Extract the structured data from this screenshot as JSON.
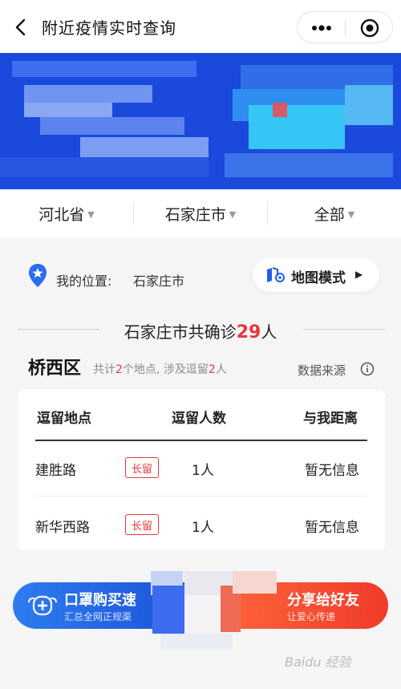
{
  "header": {
    "title": "附近疫情实时查询",
    "back_icon": "chevron-left-icon",
    "more_icon": "more-dots-icon",
    "close_icon": "target-circle-icon"
  },
  "colors": {
    "banner_blue": "#1a47d8",
    "accent_red": "#e8363d",
    "mask_blue": "#2f7cf0",
    "share_orange": "#ff6a3d"
  },
  "region": {
    "province": "河北省",
    "city": "石家庄市",
    "district": "全部"
  },
  "location": {
    "label": "我的位置:",
    "value": "石家庄市",
    "map_button": "地图模式"
  },
  "summary": {
    "prefix": "石家庄市共确诊",
    "count": "29",
    "suffix": "人"
  },
  "district": {
    "name": "桥西区",
    "info_a": "共计",
    "info_places": "2",
    "info_b": "个地点, 涉及逗留",
    "info_people": "2",
    "info_c": "人",
    "source": "数据来源"
  },
  "table": {
    "headers": [
      "逗留地点",
      "逗留人数",
      "与我距离"
    ],
    "rows": [
      {
        "place": "建胜路",
        "tag": "长留",
        "count": "1人",
        "distance": "暂无信息"
      },
      {
        "place": "新华西路",
        "tag": "长留",
        "count": "1人",
        "distance": "暂无信息"
      }
    ]
  },
  "actions": {
    "mask_title": "口罩购买速",
    "mask_sub": "汇总全网正规渠",
    "share_title": "分享给好友",
    "share_sub": "让爱心传递"
  },
  "watermark": "Baidu 经验"
}
